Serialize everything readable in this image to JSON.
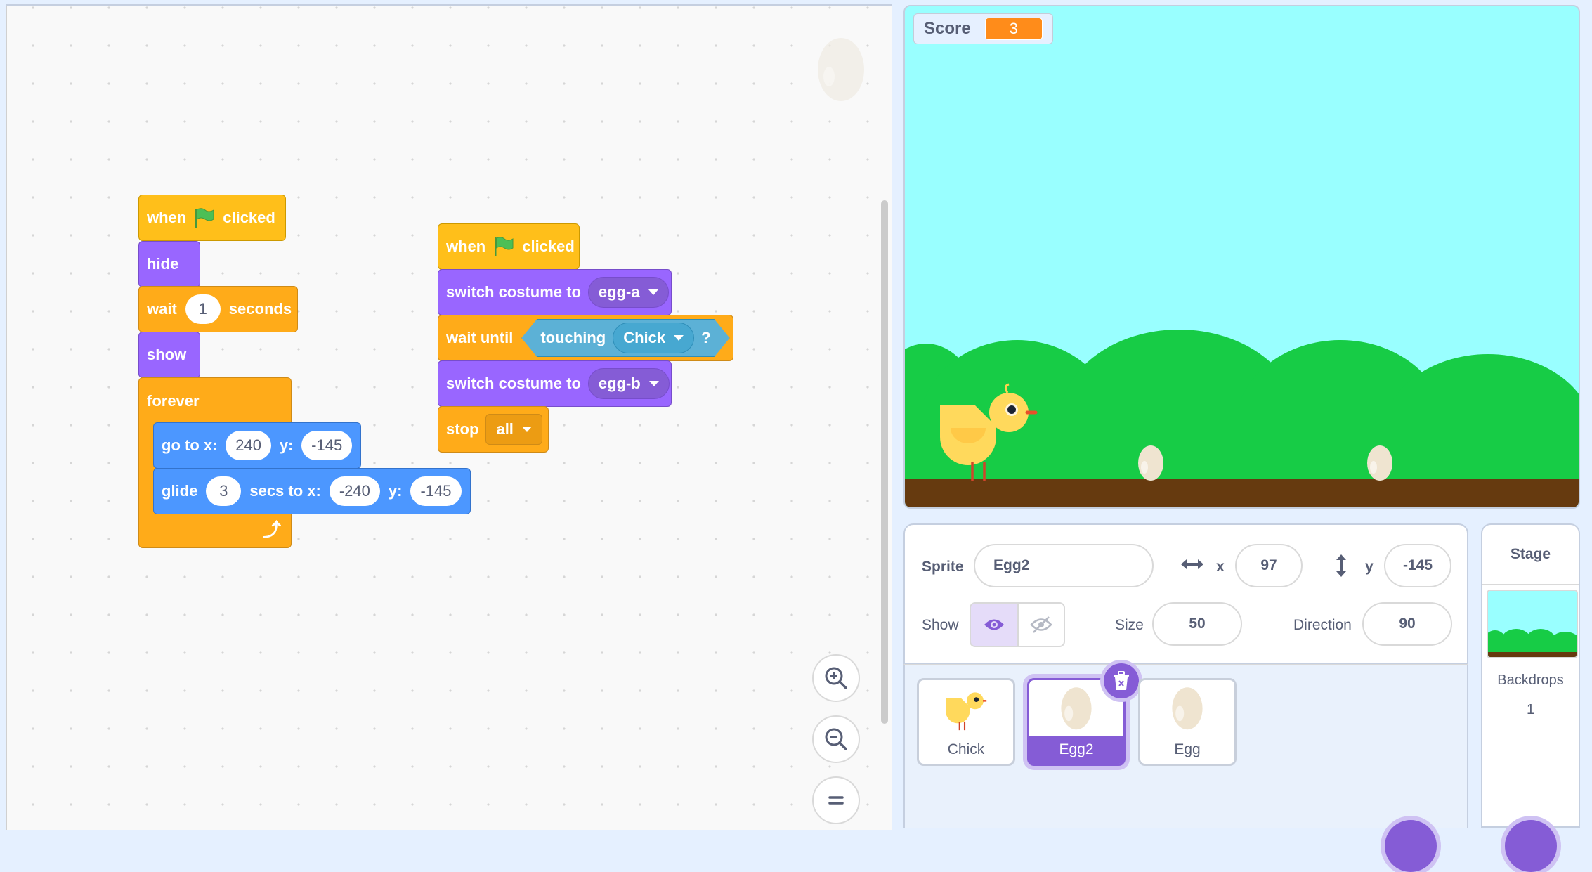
{
  "workspace": {
    "script1": {
      "hat": {
        "when": "when",
        "clicked": "clicked"
      },
      "hide": "hide",
      "wait": {
        "label": "wait",
        "value": "1",
        "unit": "seconds"
      },
      "show": "show",
      "forever": "forever",
      "goto": {
        "label": "go to x:",
        "x": "240",
        "ylabel": "y:",
        "y": "-145"
      },
      "glide": {
        "label": "glide",
        "secs": "3",
        "mid": "secs to x:",
        "x": "-240",
        "ylabel": "y:",
        "y": "-145"
      }
    },
    "script2": {
      "hat": {
        "when": "when",
        "clicked": "clicked"
      },
      "switch1": {
        "label": "switch costume to",
        "value": "egg-a"
      },
      "waituntil": {
        "label": "wait until",
        "touching": "touching",
        "target": "Chick",
        "q": "?"
      },
      "switch2": {
        "label": "switch costume to",
        "value": "egg-b"
      },
      "stop": {
        "label": "stop",
        "value": "all"
      }
    },
    "zoom_controls": [
      "zoom-in",
      "zoom-out",
      "reset-zoom"
    ]
  },
  "stage": {
    "monitor": {
      "label": "Score",
      "value": "3"
    },
    "colors": {
      "sky": "#99ffff",
      "grass": "#17cc46",
      "ground": "#663a0f"
    }
  },
  "sprite_info": {
    "sprite_label": "Sprite",
    "sprite_name": "Egg2",
    "x_label": "x",
    "x_value": "97",
    "y_label": "y",
    "y_value": "-145",
    "show_label": "Show",
    "size_label": "Size",
    "size_value": "50",
    "direction_label": "Direction",
    "direction_value": "90"
  },
  "sprites": [
    {
      "name": "Chick",
      "selected": false
    },
    {
      "name": "Egg2",
      "selected": true
    },
    {
      "name": "Egg",
      "selected": false
    }
  ],
  "stage_pane": {
    "title": "Stage",
    "backdrops_label": "Backdrops",
    "backdrops_count": "1"
  },
  "colors": {
    "accent": "#855cd6",
    "events": "#ffbf1a",
    "looks": "#9966ff",
    "control": "#ffab19",
    "motion": "#4c97ff",
    "sensing": "#5cb1d6"
  }
}
